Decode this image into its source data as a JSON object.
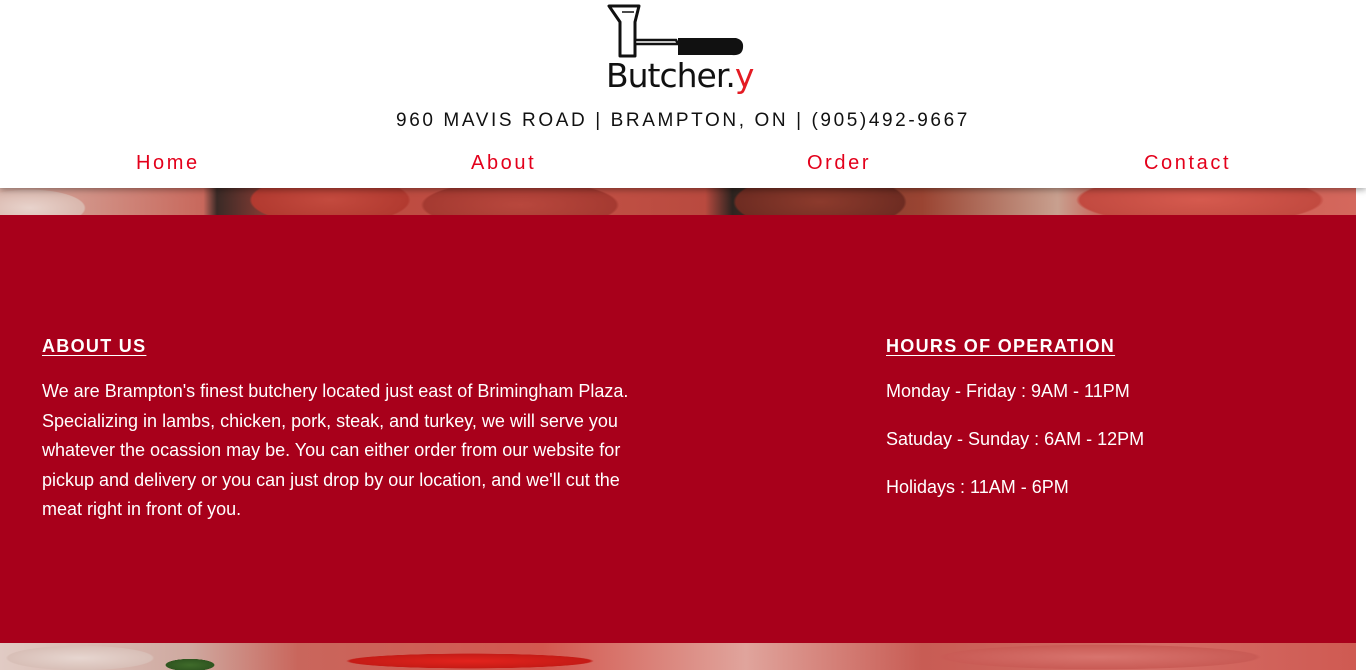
{
  "header": {
    "logo": {
      "text_main": "Butcher.",
      "text_accent": "y"
    },
    "address": "960 MAVIS ROAD | BRAMPTON, ON | (905)492-9667"
  },
  "nav": {
    "items": [
      {
        "label": "Home"
      },
      {
        "label": "About"
      },
      {
        "label": "Order"
      },
      {
        "label": "Contact"
      }
    ]
  },
  "about": {
    "heading": "ABOUT US",
    "text": "We are Brampton's finest butchery located just east of Brimingham Plaza. Specializing in lambs, chicken, pork, steak, and turkey, we will serve you whatever the ocassion may be. You can either order from our website for pickup and delivery or you can just drop by our location, and we'll cut the meat right in front of you."
  },
  "hours": {
    "heading": "HOURS OF OPERATION",
    "lines": [
      "Monday - Friday : 9AM - 11PM",
      "Satuday - Sunday : 6AM - 12PM",
      "Holidays : 11AM - 6PM"
    ]
  },
  "colors": {
    "accent_red": "#e3001b",
    "section_red": "#a8001b",
    "logo_red": "#e41b23"
  },
  "icons": {
    "logo_mark": "cleaver-icon"
  }
}
